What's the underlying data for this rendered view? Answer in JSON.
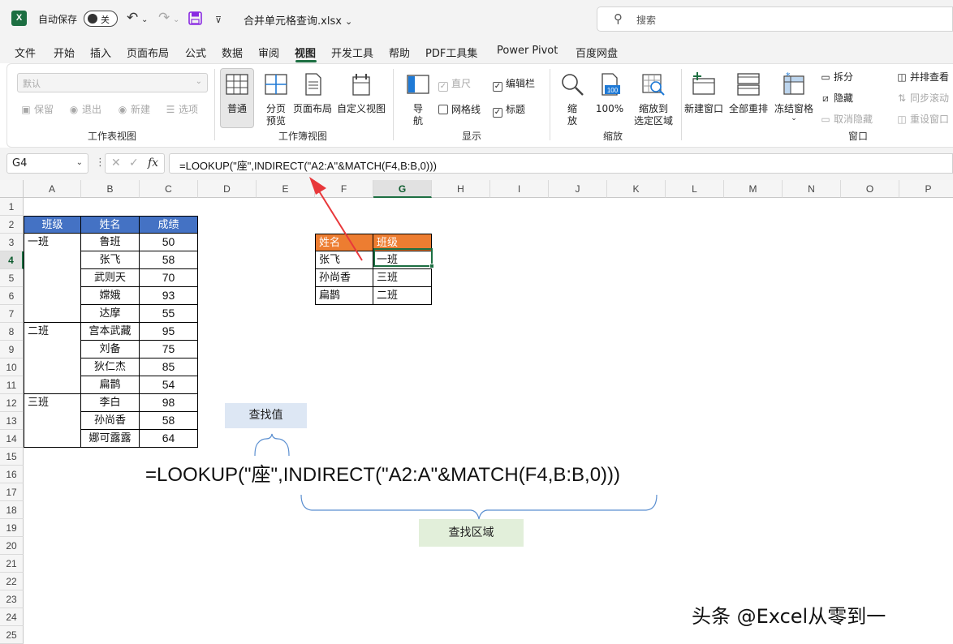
{
  "titlebar": {
    "app_logo": "X",
    "autosave_label": "自动保存",
    "autosave_state": "关",
    "filename": "合并单元格查询.xlsx",
    "search_placeholder": "搜索"
  },
  "menu": {
    "tabs": [
      "文件",
      "开始",
      "插入",
      "页面布局",
      "公式",
      "数据",
      "审阅",
      "视图",
      "开发工具",
      "帮助",
      "PDF工具集",
      "Power Pivot",
      "百度网盘"
    ],
    "active": "视图"
  },
  "ribbon": {
    "sheet_view": {
      "label": "工作表视图",
      "dropdown_value": "默认",
      "keep": "保留",
      "exit": "退出",
      "new": "新建",
      "options": "选项"
    },
    "workbook_view": {
      "label": "工作簿视图",
      "normal": "普通",
      "page_break_1": "分页",
      "page_break_2": "预览",
      "page_layout": "页面布局",
      "custom_view": "自定义视图"
    },
    "show": {
      "label": "显示",
      "navigation_1": "导",
      "navigation_2": "航",
      "ruler": "直尺",
      "formula_bar": "编辑栏",
      "gridlines": "网格线",
      "headings": "标题"
    },
    "zoom": {
      "label": "缩放",
      "zoom_1": "缩",
      "zoom_2": "放",
      "hundred": "100%",
      "hundred_icon_text": "100",
      "zoom_sel_1": "缩放到",
      "zoom_sel_2": "选定区域"
    },
    "window": {
      "label": "窗口",
      "new_window": "新建窗口",
      "arrange_all": "全部重排",
      "freeze_panes": "冻结窗格",
      "split": "拆分",
      "hide": "隐藏",
      "unhide": "取消隐藏",
      "side_by_side": "并排查看",
      "sync_scroll": "同步滚动",
      "reset_position": "重设窗口"
    }
  },
  "formula_bar": {
    "name_box": "G4",
    "formula": "=LOOKUP(\"座\",INDIRECT(\"A2:A\"&MATCH(F4,B:B,0)))"
  },
  "grid": {
    "columns": [
      "A",
      "B",
      "C",
      "D",
      "E",
      "F",
      "G",
      "H",
      "I",
      "J",
      "K",
      "L",
      "M",
      "N",
      "O",
      "P"
    ],
    "rows": [
      "1",
      "2",
      "3",
      "4",
      "5",
      "6",
      "7",
      "8",
      "9",
      "10",
      "11",
      "12",
      "13",
      "14",
      "15",
      "16",
      "17",
      "18",
      "19",
      "20",
      "21",
      "22",
      "23",
      "24",
      "25"
    ],
    "selected_cell": "G4"
  },
  "table_left": {
    "headers": [
      "班级",
      "姓名",
      "成绩"
    ],
    "groups": [
      {
        "class": "一班",
        "rows": [
          [
            "鲁班",
            "50"
          ],
          [
            "张飞",
            "58"
          ],
          [
            "武则天",
            "70"
          ],
          [
            "嫦娥",
            "93"
          ],
          [
            "达摩",
            "55"
          ]
        ]
      },
      {
        "class": "二班",
        "rows": [
          [
            "宫本武藏",
            "95"
          ],
          [
            "刘备",
            "75"
          ],
          [
            "狄仁杰",
            "85"
          ],
          [
            "扁鹊",
            "54"
          ]
        ]
      },
      {
        "class": "三班",
        "rows": [
          [
            "李白",
            "98"
          ],
          [
            "孙尚香",
            "58"
          ],
          [
            "娜可露露",
            "64"
          ]
        ]
      }
    ]
  },
  "table_right": {
    "headers": [
      "姓名",
      "班级"
    ],
    "rows": [
      [
        "张飞",
        "一班"
      ],
      [
        "孙尚香",
        "三班"
      ],
      [
        "扁鹊",
        "二班"
      ]
    ]
  },
  "annotations": {
    "lookup_value": "查找值",
    "lookup_range": "查找区域",
    "formula_display": "=LOOKUP(\"座\",INDIRECT(\"A2:A\"&MATCH(F4,B:B,0)))",
    "watermark": "头条 @Excel从零到一"
  },
  "colors": {
    "excel_green": "#1d6f42",
    "header_blue": "#4472c4",
    "header_orange": "#ed7d31",
    "arrow_red": "#e8383b",
    "brace_blue": "#5b8fd0"
  }
}
